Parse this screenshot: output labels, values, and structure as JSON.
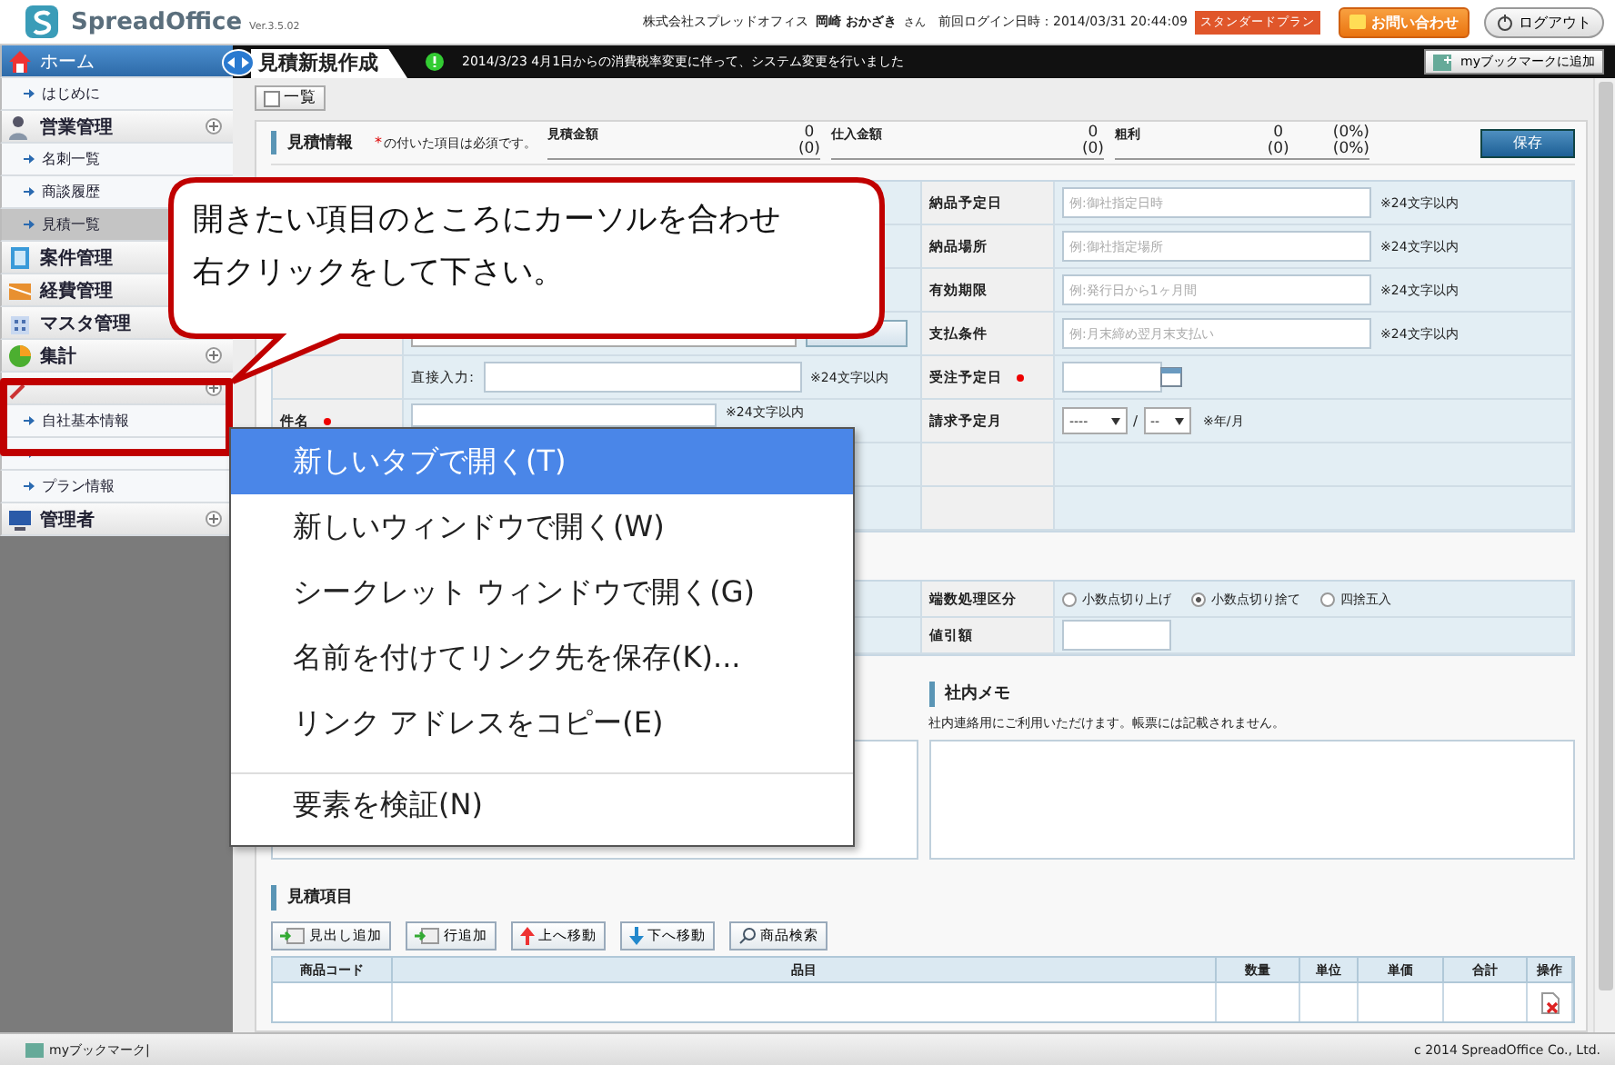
{
  "header": {
    "logo": "SpreadOffice",
    "version": "Ver.3.5.02",
    "company": "株式会社スプレッドオフィス",
    "user": "岡崎 おかざき",
    "honorific": "さん",
    "last_login": "前回ログイン日時：2014/03/31 20:44:09",
    "plan_badge": "スタンダードプラン",
    "contact_button": "お問い合わせ",
    "logout_button": "ログアウト"
  },
  "sidebar": {
    "items": [
      {
        "kind": "home",
        "label": "ホーム",
        "selected": false
      },
      {
        "kind": "link",
        "label": "はじめに",
        "selected": false
      },
      {
        "kind": "section",
        "label": "営業管理",
        "selected": false,
        "expandable": true
      },
      {
        "kind": "link",
        "label": "名刺一覧",
        "selected": false
      },
      {
        "kind": "link",
        "label": "商談履歴",
        "selected": false
      },
      {
        "kind": "link",
        "label": "見積一覧",
        "selected": true
      },
      {
        "kind": "section",
        "label": "案件管理",
        "selected": false
      },
      {
        "kind": "section",
        "label": "経費管理",
        "selected": false
      },
      {
        "kind": "section",
        "label": "マスタ管理",
        "selected": false
      },
      {
        "kind": "section",
        "label": "集計",
        "selected": false,
        "expandable": true
      },
      {
        "kind": "section",
        "selected": false,
        "expandable": true
      },
      {
        "kind": "link",
        "label": "自社基本情報",
        "selected": false
      },
      {
        "kind": "link",
        "selected": false
      },
      {
        "kind": "link",
        "label": "プラン情報",
        "selected": false
      },
      {
        "kind": "section",
        "label": "管理者",
        "selected": false,
        "expandable": true
      }
    ]
  },
  "tabbar": {
    "tab": "見積新規作成",
    "notice": "2014/3/23  4月1日からの消費税率変更に伴って、システム変更を行いました",
    "bookmark_button": "myブックマークに追加"
  },
  "list_button": "一覧",
  "estimate_info": {
    "title": "見積情報",
    "required_mark": "*",
    "required_note": "の付いた項目は必須です。",
    "amounts": [
      {
        "label": "見積金額",
        "value": "0",
        "sub": "(0)"
      },
      {
        "label": "仕入金額",
        "value": "0",
        "sub": "(0)"
      },
      {
        "label": "粗利",
        "value": "0",
        "sub": "(0)",
        "percent": "(0%)",
        "percent_sub": "(0%)"
      }
    ],
    "save_button": "保存"
  },
  "form": {
    "left_rows": [
      {
        "kind": "hidden"
      },
      {
        "kind": "hidden"
      },
      {
        "kind": "hidden"
      },
      {
        "kind": "customer"
      },
      {
        "kind": "direct",
        "label": "直接入力:",
        "note": "※24文字以内"
      },
      {
        "kind": "text",
        "label": "件名",
        "required": true,
        "note": "※24文字以内"
      },
      {
        "kind": "hidden"
      },
      {
        "kind": "hidden"
      }
    ],
    "right_rows": [
      {
        "kind": "text",
        "label": "納品予定日",
        "placeholder": "例:御社指定日時",
        "note": "※24文字以内"
      },
      {
        "kind": "text",
        "label": "納品場所",
        "placeholder": "例:御社指定場所",
        "note": "※24文字以内"
      },
      {
        "kind": "text",
        "label": "有効期限",
        "placeholder": "例:発行日から1ヶ月間",
        "note": "※24文字以内"
      },
      {
        "kind": "text",
        "label": "支払条件",
        "placeholder": "例:月末締め翌月末支払い",
        "note": "※24文字以内"
      },
      {
        "kind": "date",
        "label": "受注予定日",
        "required": true
      },
      {
        "kind": "month",
        "label": "請求予定月",
        "year": "----",
        "separator": "/",
        "month": "--",
        "note": "※年/月"
      },
      {
        "kind": "empty"
      },
      {
        "kind": "empty"
      }
    ]
  },
  "rounding": {
    "label": "端数処理区分",
    "options": [
      {
        "label": "小数点切り上げ",
        "selected": false
      },
      {
        "label": "小数点切り捨て",
        "selected": true
      },
      {
        "label": "四捨五入",
        "selected": false
      }
    ]
  },
  "discount": {
    "label": "値引額"
  },
  "memo": {
    "title": "社内メモ",
    "note": "社内連絡用にご利用いただけます。帳票には記載されません。"
  },
  "items": {
    "title": "見積項目",
    "buttons": [
      {
        "kind": "heading",
        "label": "見出し追加"
      },
      {
        "kind": "row",
        "label": "行追加"
      },
      {
        "kind": "up",
        "label": "上へ移動"
      },
      {
        "kind": "down",
        "label": "下へ移動"
      },
      {
        "kind": "search",
        "label": "商品検索"
      }
    ],
    "columns": [
      "商品コード",
      "品目",
      "数量",
      "単位",
      "単価",
      "合計",
      "操作"
    ]
  },
  "callout": {
    "lines": [
      "開きたい項目のところにカーソルを合わせ",
      "右クリックをして下さい。"
    ]
  },
  "context_menu": {
    "items": [
      {
        "label": "新しいタブで開く(T)",
        "selected": true,
        "separator_before": false
      },
      {
        "label": "新しいウィンドウで開く(W)",
        "selected": false,
        "separator_before": false
      },
      {
        "label": "シークレット ウィンドウで開く(G)",
        "selected": false,
        "separator_before": false
      },
      {
        "label": "名前を付けてリンク先を保存(K)...",
        "selected": false,
        "separator_before": false
      },
      {
        "label": "リンク アドレスをコピー(E)",
        "selected": false,
        "separator_before": false
      },
      {
        "label": "要素を検証(N)",
        "selected": false,
        "separator_before": true
      }
    ]
  },
  "footer": {
    "bookmark": "myブックマーク|",
    "copyright": "c 2014 SpreadOffice Co., Ltd."
  }
}
